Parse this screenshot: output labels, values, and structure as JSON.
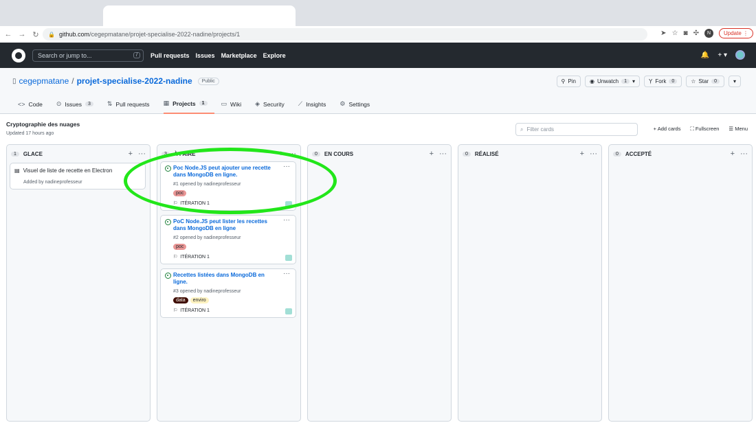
{
  "browser": {
    "url_host": "github.com",
    "url_path": "/cegepmatane/projet-specialise-2022-nadine/projects/1",
    "profile_initial": "N",
    "update_label": "Update"
  },
  "gh_header": {
    "search_placeholder": "Search or jump to...",
    "search_key": "/",
    "nav": [
      "Pull requests",
      "Issues",
      "Marketplace",
      "Explore"
    ]
  },
  "repo": {
    "owner": "cegepmatane",
    "separator": "/",
    "name": "projet-specialise-2022-nadine",
    "visibility": "Public",
    "pin_label": "Pin",
    "watch_label": "Unwatch",
    "watch_count": "1",
    "fork_label": "Fork",
    "fork_count": "0",
    "star_label": "Star",
    "star_count": "0"
  },
  "tabs": [
    {
      "label": "Code",
      "icon": "<>"
    },
    {
      "label": "Issues",
      "count": "3",
      "icon": "⊙"
    },
    {
      "label": "Pull requests",
      "icon": "⇅"
    },
    {
      "label": "Projects",
      "count": "1",
      "icon": "▦"
    },
    {
      "label": "Wiki",
      "icon": "▭"
    },
    {
      "label": "Security",
      "icon": "◈"
    },
    {
      "label": "Insights",
      "icon": "⟋"
    },
    {
      "label": "Settings",
      "icon": "⚙"
    }
  ],
  "project": {
    "name": "Cryptographie des nuages",
    "updated": "Updated 17 hours ago",
    "filter_placeholder": "Filter cards",
    "add_cards": "Add cards",
    "fullscreen": "Fullscreen",
    "menu": "Menu"
  },
  "columns": [
    {
      "count": "1",
      "name": "GLACE",
      "note": {
        "title": "Visuel de liste de recette en Electron",
        "meta": "Added by nadineprofesseur"
      }
    },
    {
      "count": "3",
      "name": "À FAIRE",
      "cards": [
        {
          "title": "Poc Node.JS peut ajouter une recette dans MongoDB en ligne.",
          "meta": "#1 opened by nadineprofesseur",
          "labels": [
            "poc"
          ],
          "iteration": "ITÉRATION 1"
        },
        {
          "title": "PoC Node.JS peut lister les recettes dans MongoDB en ligne",
          "meta": "#2 opened by nadineprofesseur",
          "labels": [
            "poc"
          ],
          "iteration": "ITÉRATION 1"
        },
        {
          "title": "Recettes listées dans MongoDB en ligne.",
          "meta": "#3 opened by nadineprofesseur",
          "labels": [
            "data",
            "enviro"
          ],
          "iteration": "ITÉRATION 1"
        }
      ]
    },
    {
      "count": "0",
      "name": "EN COURS"
    },
    {
      "count": "0",
      "name": "RÉALISÉ"
    },
    {
      "count": "0",
      "name": "ACCEPTÉ"
    }
  ],
  "colors": {
    "header_bg": "#24292f",
    "link": "#0969da",
    "highlight": "#22e61a",
    "label_poc": "#e99695",
    "label_data": "#3f0c00",
    "label_enviro": "#fef2c0"
  }
}
